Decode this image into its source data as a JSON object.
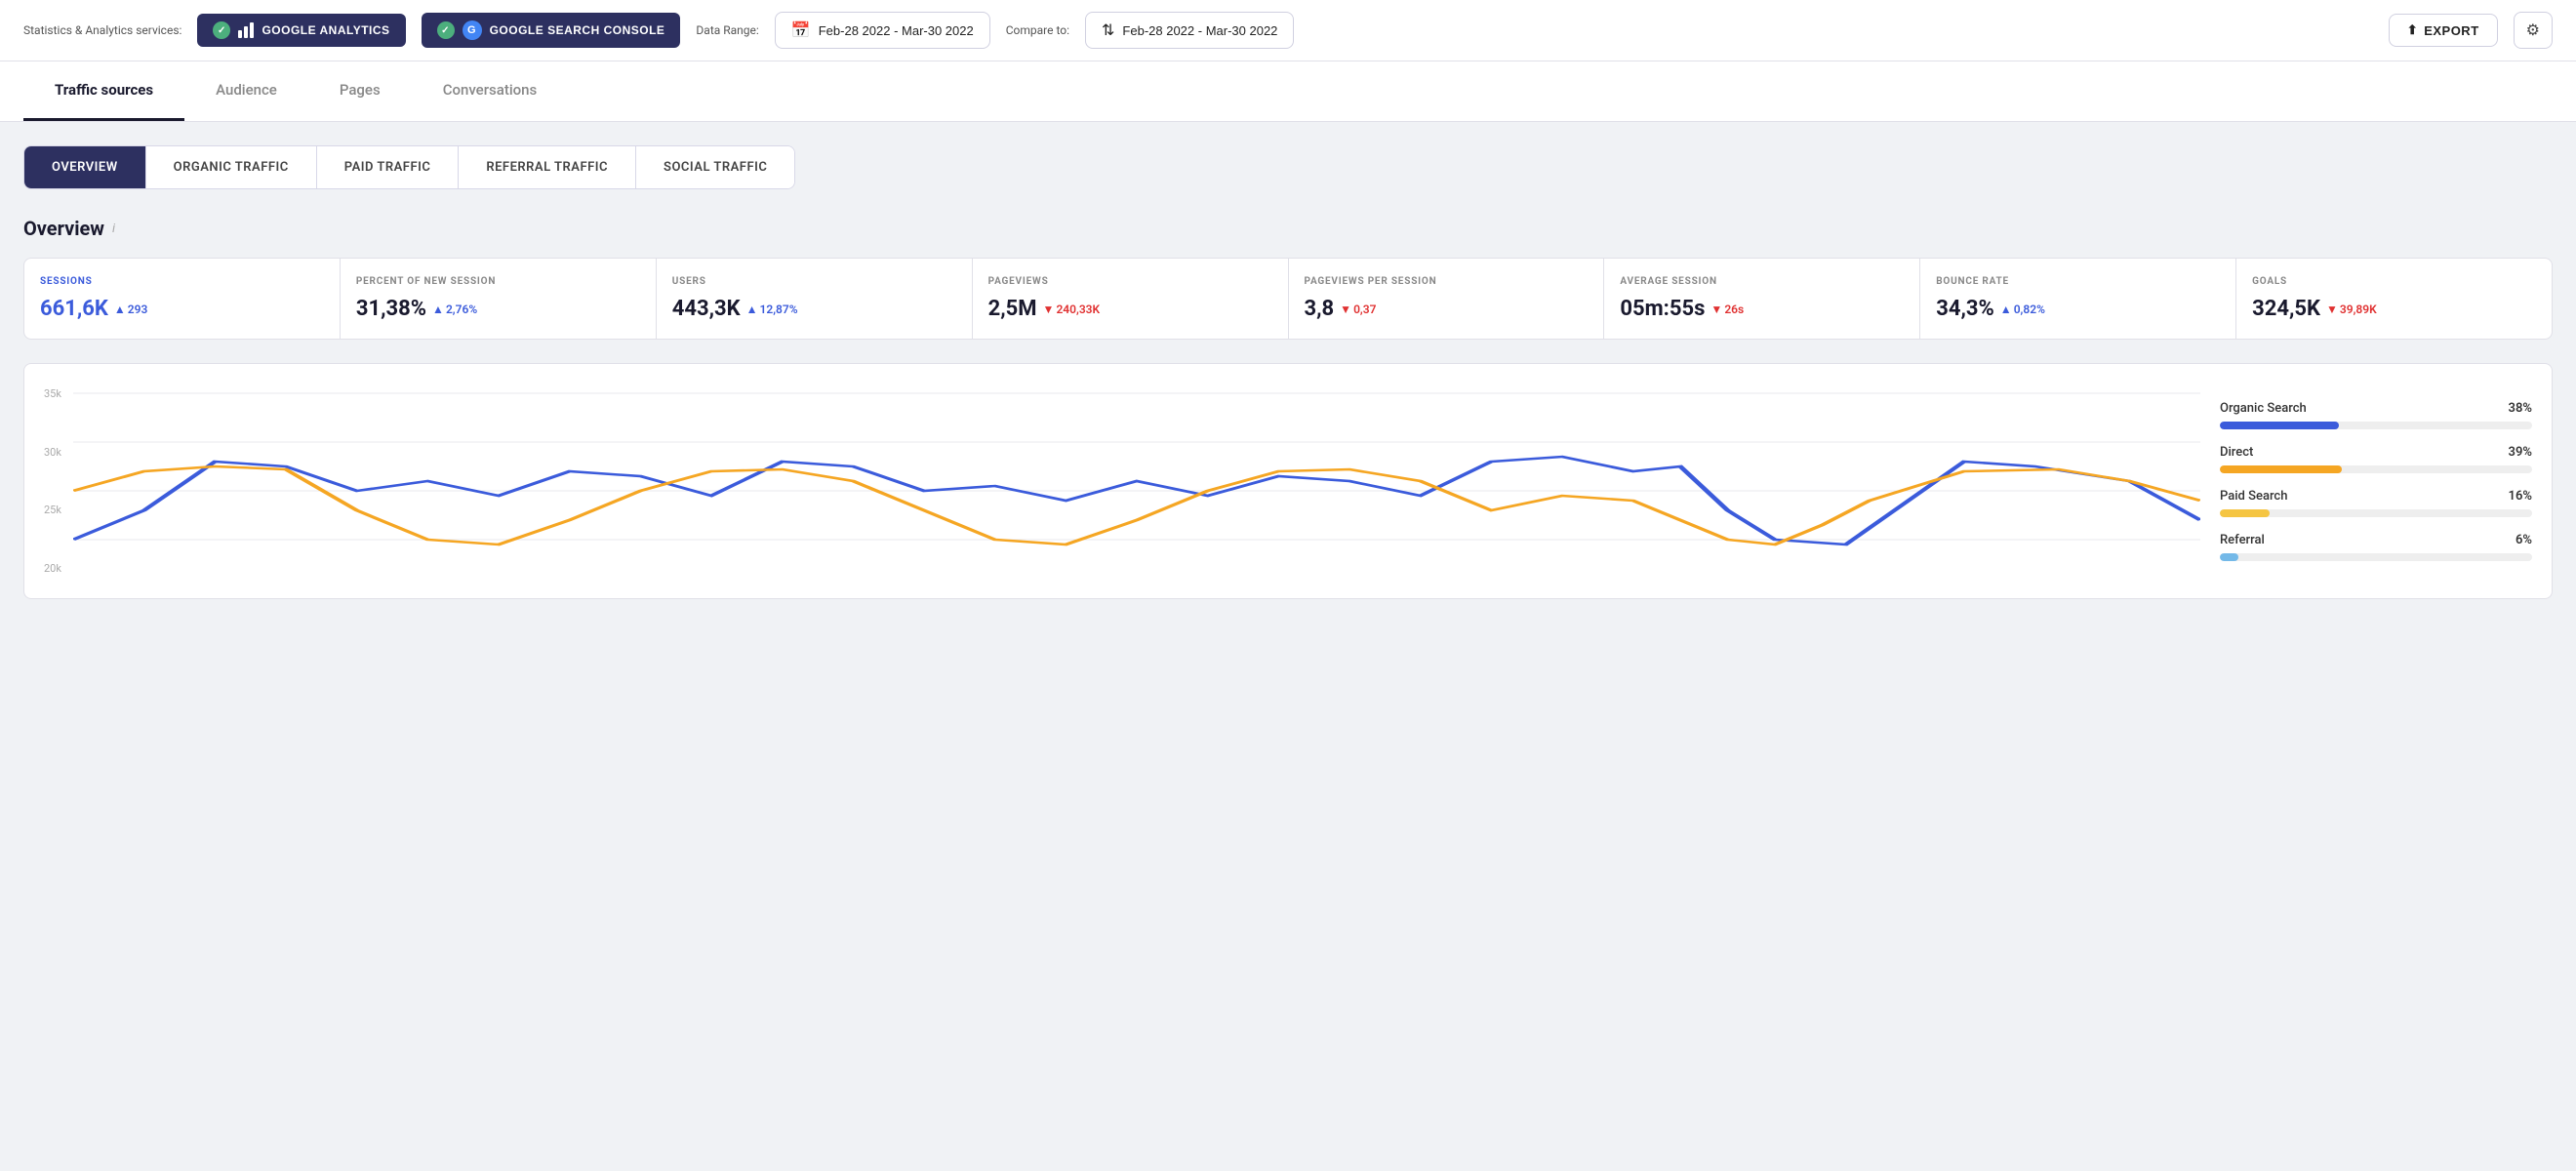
{
  "topBar": {
    "label": "Statistics & Analytics services:",
    "services": [
      {
        "name": "google-analytics",
        "label": "GOOGLE ANALYTICS",
        "icon": "bar-chart"
      },
      {
        "name": "google-search-console",
        "label": "GOOGLE SEARCH CONSOLE",
        "icon": "g-circle"
      }
    ],
    "dataRangeLabel": "Data Range:",
    "dataRange": "Feb-28 2022 - Mar-30 2022",
    "compareToLabel": "Compare to:",
    "compareTo": "Feb-28 2022 - Mar-30 2022",
    "exportLabel": "EXPORT"
  },
  "tabs": {
    "items": [
      {
        "id": "traffic-sources",
        "label": "Traffic sources",
        "active": true
      },
      {
        "id": "audience",
        "label": "Audience",
        "active": false
      },
      {
        "id": "pages",
        "label": "Pages",
        "active": false
      },
      {
        "id": "conversations",
        "label": "Conversations",
        "active": false
      }
    ]
  },
  "subTabs": {
    "items": [
      {
        "id": "overview",
        "label": "OVERVIEW",
        "active": true
      },
      {
        "id": "organic-traffic",
        "label": "ORGANIC TRAFFIC",
        "active": false
      },
      {
        "id": "paid-traffic",
        "label": "PAID TRAFFIC",
        "active": false
      },
      {
        "id": "referral-traffic",
        "label": "REFERRAL TRAFFIC",
        "active": false
      },
      {
        "id": "social-traffic",
        "label": "SOCIAL TRAFFIC",
        "active": false
      }
    ]
  },
  "overviewTitle": "Overview",
  "overviewInfo": "i",
  "metrics": [
    {
      "id": "sessions",
      "label": "SESSIONS",
      "labelClass": "blue",
      "value": "661,6K",
      "valueClass": "blue",
      "deltaDir": "up",
      "delta": "293"
    },
    {
      "id": "percent-new-session",
      "label": "PERCENT OF NEW SESSION",
      "labelClass": "",
      "value": "31,38%",
      "valueClass": "",
      "deltaDir": "up",
      "delta": "2,76%"
    },
    {
      "id": "users",
      "label": "USERS",
      "labelClass": "",
      "value": "443,3K",
      "valueClass": "",
      "deltaDir": "up",
      "delta": "12,87%"
    },
    {
      "id": "pageviews",
      "label": "PAGEVIEWS",
      "labelClass": "",
      "value": "2,5M",
      "valueClass": "",
      "deltaDir": "down",
      "delta": "240,33K"
    },
    {
      "id": "pageviews-per-session",
      "label": "PAGEVIEWS PER SESSION",
      "labelClass": "",
      "value": "3,8",
      "valueClass": "",
      "deltaDir": "down",
      "delta": "0,37"
    },
    {
      "id": "average-session",
      "label": "AVERAGE SESSION",
      "labelClass": "",
      "value": "05m:55s",
      "valueClass": "",
      "deltaDir": "down",
      "delta": "26s"
    },
    {
      "id": "bounce-rate",
      "label": "BOUNCE RATE",
      "labelClass": "",
      "value": "34,3%",
      "valueClass": "",
      "deltaDir": "up",
      "delta": "0,82%"
    },
    {
      "id": "goals",
      "label": "GOALS",
      "labelClass": "",
      "value": "324,5K",
      "valueClass": "",
      "deltaDir": "down",
      "delta": "39,89K"
    }
  ],
  "chartYAxis": [
    "35k",
    "30k",
    "25k",
    "20k"
  ],
  "legend": {
    "items": [
      {
        "id": "organic-search",
        "label": "Organic Search",
        "pct": "38%",
        "fill": "38",
        "colorClass": "bar-blue"
      },
      {
        "id": "direct",
        "label": "Direct",
        "pct": "39%",
        "fill": "39",
        "colorClass": "bar-yellow"
      },
      {
        "id": "paid-search",
        "label": "Paid Search",
        "pct": "16%",
        "fill": "16",
        "colorClass": "bar-yellow2"
      },
      {
        "id": "referral",
        "label": "Referral",
        "pct": "6%",
        "fill": "6",
        "colorClass": "bar-lightblue"
      }
    ]
  }
}
